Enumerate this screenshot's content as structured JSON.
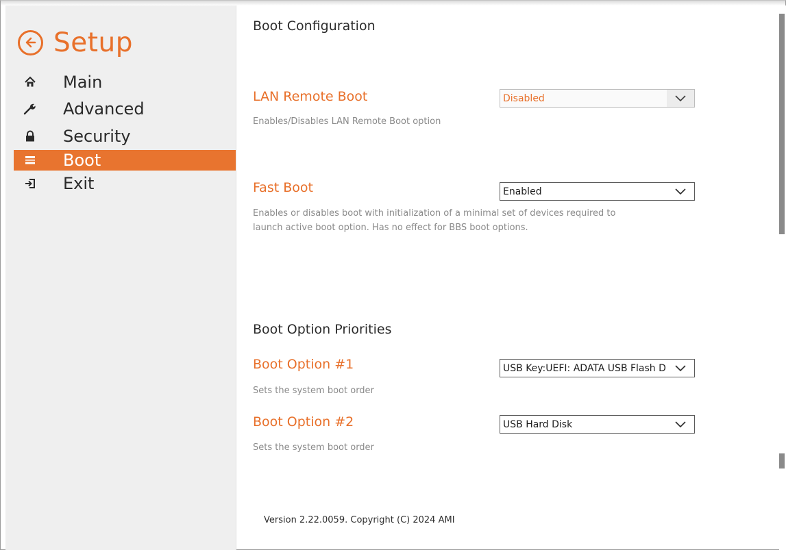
{
  "sidebar": {
    "title": "Setup",
    "items": [
      {
        "label": "Main",
        "icon": "home-icon"
      },
      {
        "label": "Advanced",
        "icon": "wrench-icon"
      },
      {
        "label": "Security",
        "icon": "lock-icon"
      },
      {
        "label": "Boot",
        "icon": "boot-icon",
        "active": true
      },
      {
        "label": "Exit",
        "icon": "exit-icon"
      }
    ]
  },
  "main": {
    "title": "Boot Configuration",
    "lan_remote_boot": {
      "label": "LAN Remote Boot",
      "value": "Disabled",
      "description": "Enables/Disables LAN Remote Boot option"
    },
    "fast_boot": {
      "label": "Fast Boot",
      "value": "Enabled",
      "description_line1": "Enables or disables boot with initialization of a minimal set of devices required to",
      "description_line2": "launch active boot option. Has no effect for BBS boot options."
    },
    "priorities_title": "Boot Option Priorities",
    "boot_option_1": {
      "label": "Boot Option #1",
      "value": "USB Key:UEFI: ADATA USB Flash Drive",
      "description": "Sets the system boot order"
    },
    "boot_option_2": {
      "label": "Boot Option #2",
      "value": "USB Hard Disk",
      "description": "Sets the system boot order"
    }
  },
  "footer": {
    "version": "Version 2.22.0059. Copyright (C) 2024 AMI"
  },
  "colors": {
    "accent": "#e8702a",
    "sidebar_bg": "#efefef"
  }
}
